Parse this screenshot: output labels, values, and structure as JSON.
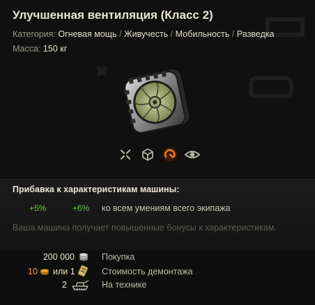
{
  "item": {
    "title": "Улучшенная вентиляция (Класс 2)",
    "category_label": "Категория:",
    "categories": [
      "Огневая мощь",
      "Живучесть",
      "Мобильность",
      "Разведка"
    ],
    "separator": "/",
    "mass_label": "Масса:",
    "mass_value": "150 кг",
    "image_icon": "ventilation-fan-icon"
  },
  "category_icons": [
    {
      "name": "firepower-icon",
      "active": false
    },
    {
      "name": "survivability-icon",
      "active": false
    },
    {
      "name": "mobility-icon",
      "active": true
    },
    {
      "name": "stealth-icon",
      "active": false
    }
  ],
  "bonus": {
    "title": "Прибавка к характеристикам машины:",
    "value_a": "+5%",
    "value_b": "+6%",
    "description": "ко всем умениям всего экипажа",
    "note": "Ваша машина получает повышенные бонусы к характеристикам."
  },
  "prices": {
    "purchase_value": "200 000",
    "purchase_icon": "credits-icon",
    "purchase_label": "Покупка",
    "demount_gold": "10",
    "demount_gold_icon": "gold-icon",
    "demount_or": "или 1",
    "demount_kit_icon": "demount-kit-icon",
    "demount_label": "Стоимость демонтажа",
    "on_vehicle_value": "2",
    "on_vehicle_icon": "tank-icon",
    "on_vehicle_label": "На технике"
  },
  "colors": {
    "bonus_green": "#5fcf3a",
    "gold": "#f2a524",
    "active_icon": "#f07a1e"
  }
}
